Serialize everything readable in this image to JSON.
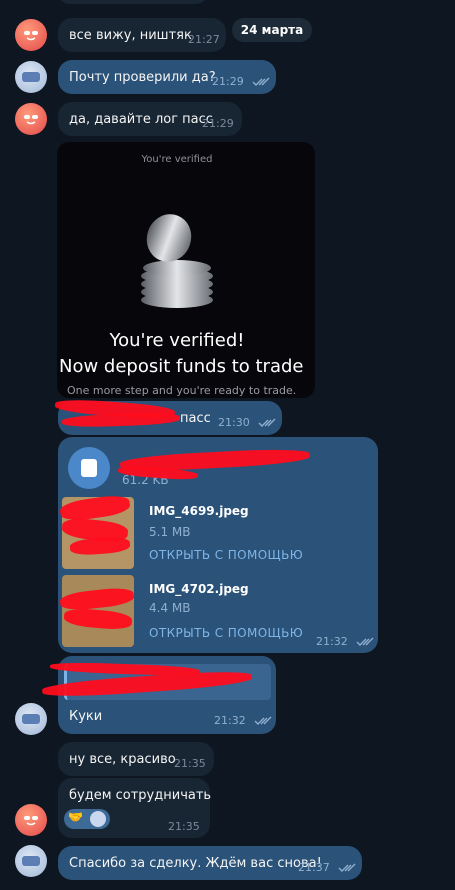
{
  "date_separator": "24 марта",
  "messages": [
    {
      "text": "все вижу, ништяк",
      "time": "21:27"
    },
    {
      "text": "Почту проверили да?",
      "time": "21:29"
    },
    {
      "text": "да, давайте лог пасс",
      "time": "21:29"
    },
    {
      "text": "пасс",
      "time": "21:30"
    },
    {
      "text": "Куки",
      "time": "21:32"
    },
    {
      "text": "ну все, красиво",
      "time": "21:35"
    },
    {
      "text": "будем сотрудничать",
      "time": "21:35",
      "reaction": "🤝"
    },
    {
      "text": "Спасибо за сделку. Ждём вас снова!",
      "time": "21:37"
    }
  ],
  "verified_card": {
    "header": "You're verified",
    "title_line1": "You're verified!",
    "title_line2": "Now deposit funds to trade",
    "subtitle": "One more step and you're ready to trade."
  },
  "files": {
    "doc_size": "61.2 KB",
    "items": [
      {
        "name": "IMG_4699.jpeg",
        "size": "5.1 MB",
        "action": "ОТКРЫТЬ С ПОМОЩЬЮ"
      },
      {
        "name": "IMG_4702.jpeg",
        "size": "4.4 MB",
        "action": "ОТКРЫТЬ С ПОМОЩЬЮ"
      }
    ],
    "time": "21:32"
  },
  "colors": {
    "background": "#0e1621",
    "incoming": "#182533",
    "outgoing": "#2b5278",
    "accent": "#7eb5e8",
    "redaction": "#ff0d1d"
  }
}
